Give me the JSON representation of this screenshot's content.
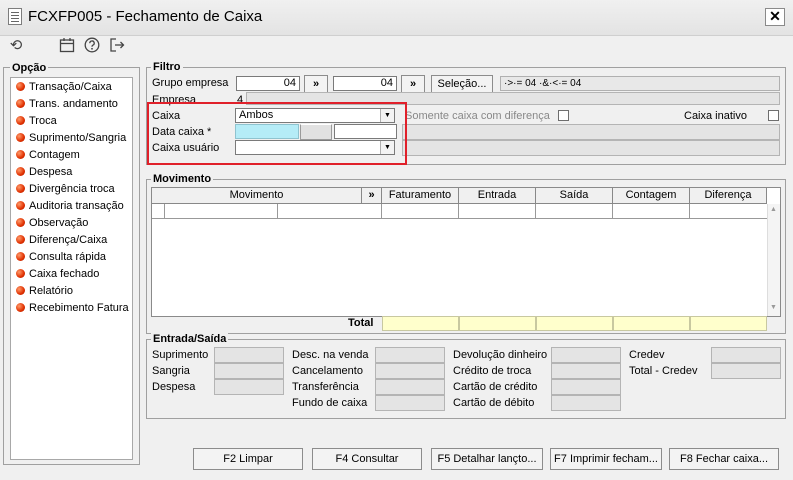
{
  "window": {
    "title": "FCXFP005 - Fechamento de Caixa",
    "close": "✕"
  },
  "toolbar": {
    "refresh": "⟲",
    "calendar": "▦",
    "help": "?",
    "exit": "↦"
  },
  "opcao": {
    "title": "Opção",
    "items": [
      "Transação/Caixa",
      "Trans. andamento",
      "Troca",
      "Suprimento/Sangria",
      "Contagem",
      "Despesa",
      "Divergência troca",
      "Auditoria transação",
      "Observação",
      "Diferença/Caixa",
      "Consulta rápida",
      "Caixa fechado",
      "Relatório",
      "Recebimento Fatura"
    ]
  },
  "filtro": {
    "title": "Filtro",
    "grupo_label": "Grupo empresa",
    "grupo_from": "04",
    "grupo_to": "04",
    "arrow": "»",
    "selecao": "Seleção...",
    "selection_text": "·>·= 04 ·&·<·= 04",
    "empresa_label": "Empresa",
    "empresa_value": "4",
    "caixa_label": "Caixa",
    "caixa_value": "Ambos",
    "somente_label": "Somente caixa com diferença",
    "inativo_label": "Caixa inativo",
    "data_label": "Data caixa *",
    "usuario_label": "Caixa usuário",
    "usuario_value": ""
  },
  "movimento": {
    "title": "Movimento",
    "columns": [
      "Movimento",
      "»",
      "Faturamento",
      "Entrada",
      "Saída",
      "Contagem",
      "Diferença"
    ],
    "total_label": "Total"
  },
  "entrada": {
    "title": "Entrada/Saída",
    "col1": [
      "Suprimento",
      "Sangria",
      "Despesa"
    ],
    "col2": [
      "Desc. na venda",
      "Cancelamento",
      "Transferência",
      "Fundo de caixa"
    ],
    "col3": [
      "Devolução dinheiro",
      "Crédito de troca",
      "Cartão de crédito",
      "Cartão de débito"
    ],
    "col4": [
      "Credev",
      "Total - Credev"
    ]
  },
  "buttons": {
    "limpar": "F2 Limpar",
    "consultar": "F4 Consultar",
    "detalhar": "F5 Detalhar lançto...",
    "imprimir": "F7 Imprimir fecham...",
    "fechar": "F8 Fechar caixa..."
  },
  "colors": {
    "highlight": "#e0202a",
    "date_field": "#b5ecf7",
    "total_fields": "#ffffcc"
  }
}
